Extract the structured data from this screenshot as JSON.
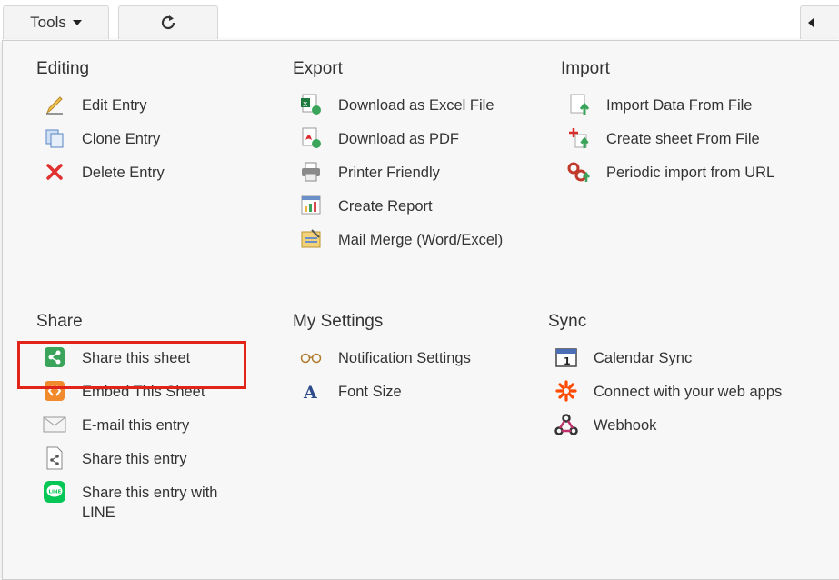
{
  "toolbar": {
    "tools_label": "Tools"
  },
  "sections": {
    "editing": {
      "title": "Editing",
      "items": [
        "Edit Entry",
        "Clone Entry",
        "Delete Entry"
      ]
    },
    "export": {
      "title": "Export",
      "items": [
        "Download as Excel File",
        "Download as PDF",
        "Printer Friendly",
        "Create Report",
        "Mail Merge (Word/Excel)"
      ]
    },
    "import": {
      "title": "Import",
      "items": [
        "Import Data From File",
        "Create sheet From File",
        "Periodic import from URL"
      ]
    },
    "share": {
      "title": "Share",
      "items": [
        "Share this sheet",
        "Embed This Sheet",
        "E-mail this entry",
        "Share this entry",
        "Share this entry with LINE"
      ]
    },
    "settings": {
      "title": "My Settings",
      "items": [
        "Notification Settings",
        "Font Size"
      ]
    },
    "sync": {
      "title": "Sync",
      "items": [
        "Calendar Sync",
        "Connect with your web apps",
        "Webhook"
      ]
    }
  },
  "colors": {
    "highlight": "#e2231a",
    "share_green": "#3aa55a",
    "embed_orange": "#f08a2c",
    "line_green": "#06c755"
  }
}
